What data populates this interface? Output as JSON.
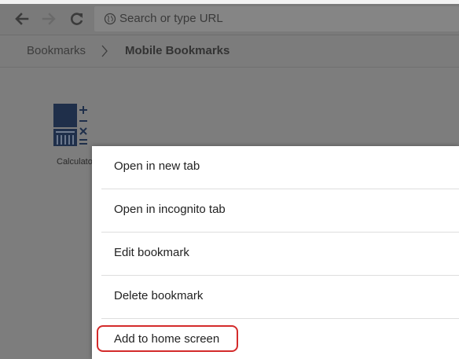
{
  "toolbar": {
    "back_icon": "back-arrow-icon",
    "forward_icon": "forward-arrow-icon",
    "reload_icon": "reload-icon",
    "omnibox_placeholder": "Search or type URL"
  },
  "breadcrumb": {
    "root": "Bookmarks",
    "separator_icon": "chevron-right-icon",
    "current": "Mobile Bookmarks"
  },
  "bookmarks": [
    {
      "label": "Calculato",
      "icon": "calculator-icon"
    }
  ],
  "context_menu": {
    "items": [
      {
        "label": "Open in new tab"
      },
      {
        "label": "Open in incognito tab"
      },
      {
        "label": "Edit bookmark"
      },
      {
        "label": "Delete bookmark"
      },
      {
        "label": "Add to home screen",
        "highlighted": true
      }
    ]
  },
  "colors": {
    "dim_overlay": "#7d7d7d",
    "menu_bg": "#ffffff",
    "highlight": "#d42b2b",
    "calc_icon_blue": "#1f2f4a"
  }
}
